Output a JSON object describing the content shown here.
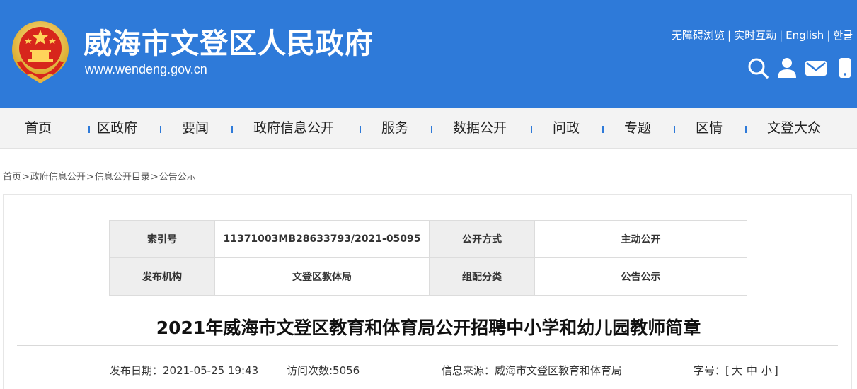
{
  "header": {
    "title": "威海市文登区人民政府",
    "url": "www.wendeng.gov.cn",
    "links": [
      "无障碍浏览",
      "实时互动",
      "English",
      "한글"
    ],
    "link_separator": "|",
    "icons": [
      "search-icon",
      "user-icon",
      "mail-icon",
      "mobile-icon"
    ],
    "background_color": "#2e7ad9"
  },
  "nav": {
    "items": [
      "首页",
      "区政府",
      "要闻",
      "政府信息公开",
      "服务",
      "数据公开",
      "问政",
      "专题",
      "区情",
      "文登大众"
    ]
  },
  "breadcrumb": {
    "items": [
      "首页",
      "政府信息公开",
      "信息公开目录",
      "公告公示"
    ],
    "separator": ">"
  },
  "meta": {
    "index_label": "索引号",
    "index_value": "11371003MB28633793/2021-05095",
    "open_mode_label": "公开方式",
    "open_mode_value": "主动公开",
    "publisher_label": "发布机构",
    "publisher_value": "文登区教体局",
    "category_label": "组配分类",
    "category_value": "公告公示"
  },
  "article": {
    "title": "2021年威海市文登区教育和体育局公开招聘中小学和幼儿园教师简章",
    "publish_date": "发布日期：2021-05-25 19:43",
    "visits": "访问次数:5056",
    "source": "信息来源：威海市文登区教育和体育局",
    "font_size_label": "字号：[",
    "font_sizes": [
      "大",
      "中",
      "小"
    ],
    "font_size_close": "]"
  }
}
